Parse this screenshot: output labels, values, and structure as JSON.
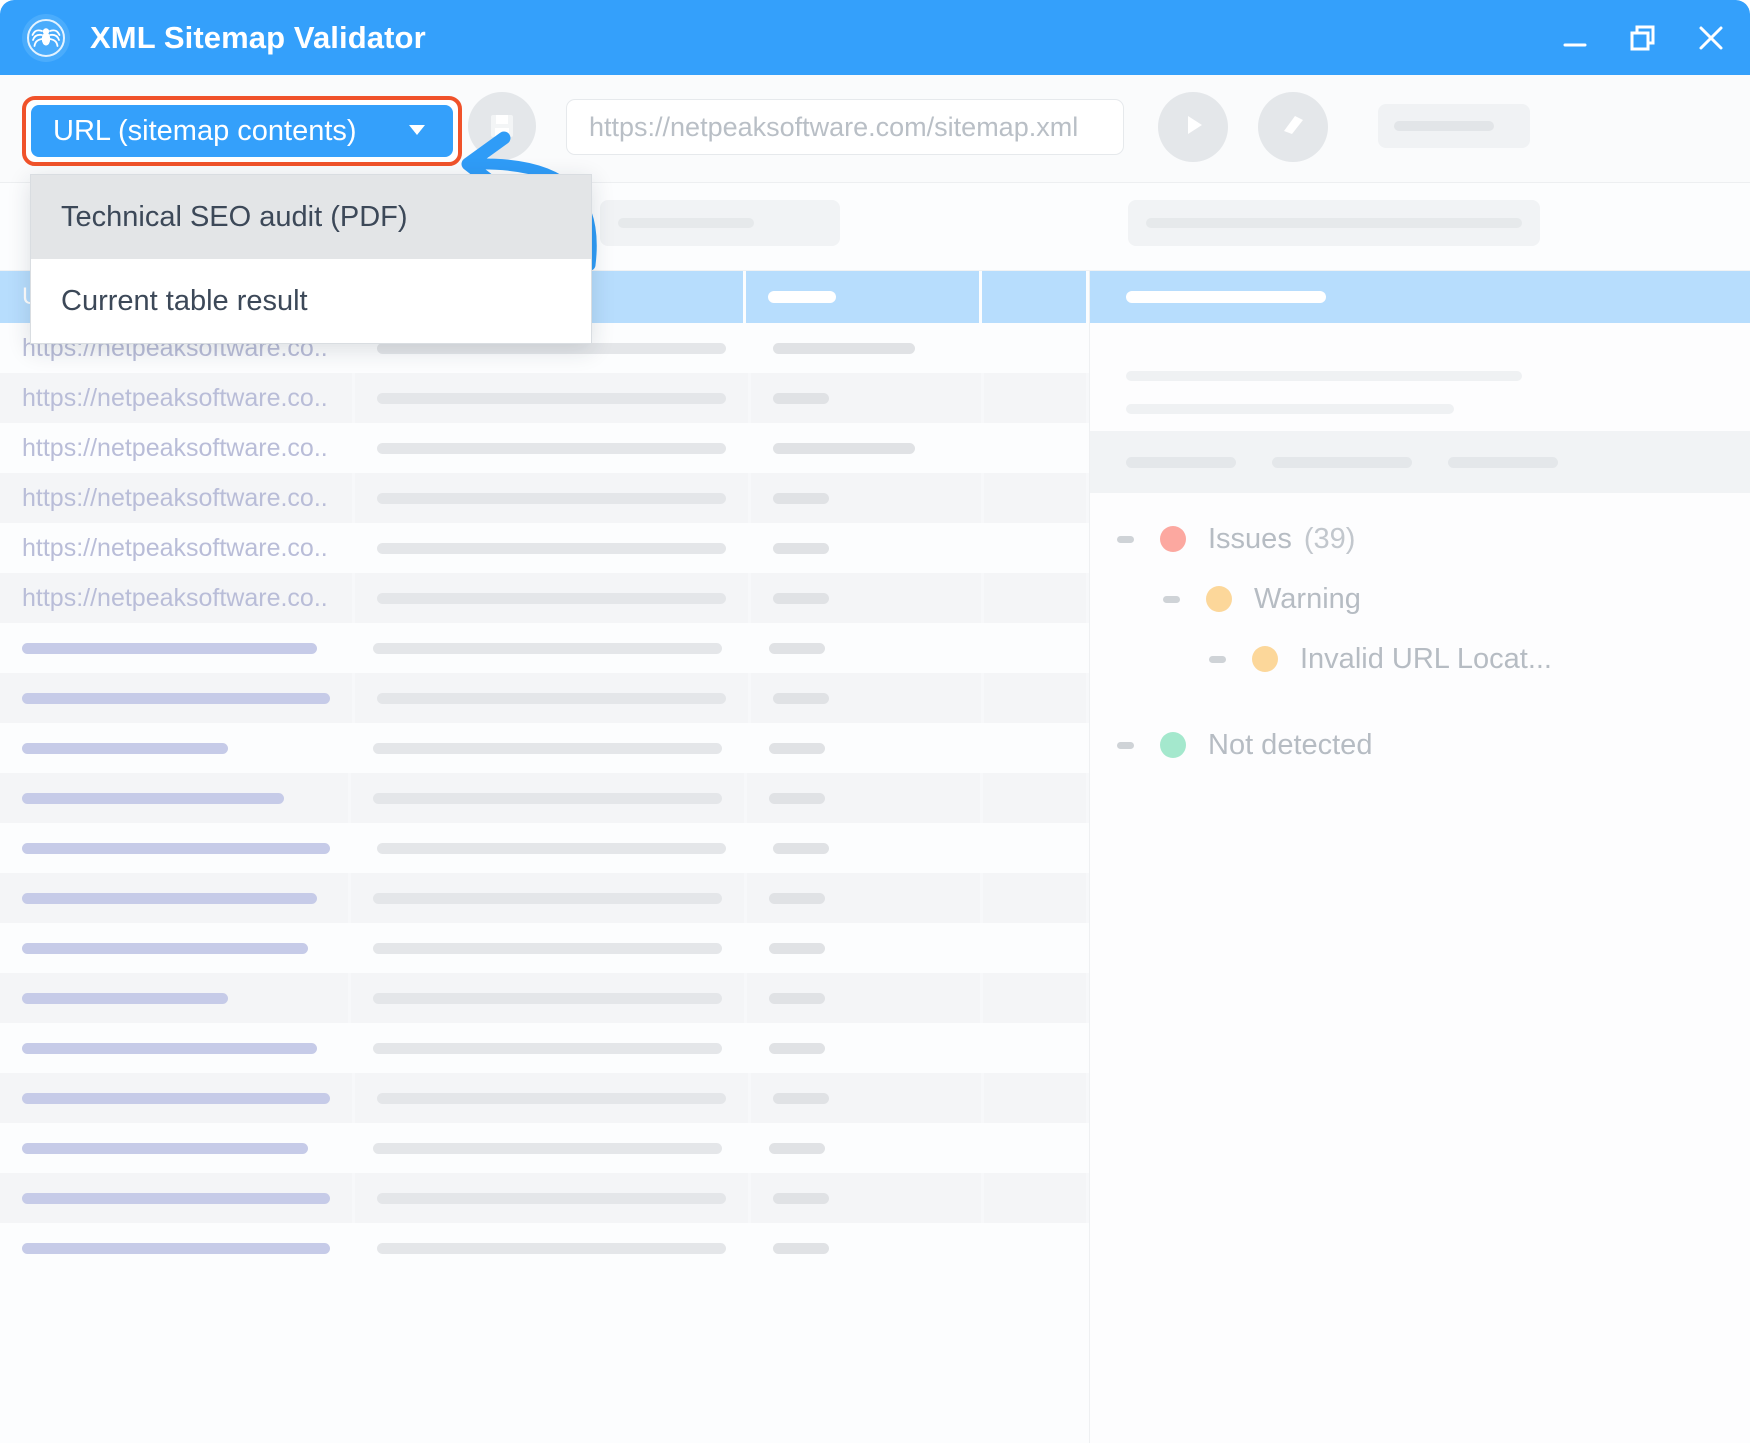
{
  "window": {
    "title": "XML Sitemap Validator",
    "logo_icon": "spider-icon",
    "minimize_icon": "minimize-icon",
    "restore_icon": "restore-window-icon",
    "close_icon": "close-icon"
  },
  "toolbar": {
    "source_select": {
      "label": "URL (sitemap contents)",
      "caret_icon": "chevron-down-icon",
      "highlight_color": "#f0522a",
      "accent_color": "#34a0fb"
    },
    "url_input": {
      "value": "https://netpeaksoftware.com/sitemap.xml",
      "placeholder": "https://netpeaksoftware.com/sitemap.xml"
    },
    "start_button_icon": "play-icon",
    "clear_button_icon": "eraser-icon",
    "export_button_icon": "save-icon"
  },
  "dropdown": {
    "open": true,
    "items": [
      {
        "label": "Technical SEO audit (PDF)",
        "hovered": true
      },
      {
        "label": "Current table result",
        "hovered": false
      }
    ]
  },
  "annotation": {
    "arrow_color": "#2f9cf7",
    "arrow_icon": "curved-left-arrow-icon"
  },
  "table": {
    "columns": [
      {
        "key": "url",
        "header_label": "URL",
        "header_bar_width": 50
      },
      {
        "key": "col2",
        "header_label": "",
        "header_bar_width": 200
      },
      {
        "key": "col3",
        "header_label": "",
        "header_bar_width": 68
      },
      {
        "key": "col4",
        "header_label": "",
        "header_bar_width": 0
      }
    ],
    "rows": [
      {
        "url_text": "https://netpeaksoftware.co...",
        "bar1": 0,
        "bar2": 360,
        "bar3": 142,
        "alt": false
      },
      {
        "url_text": "https://netpeaksoftware.co...",
        "bar1": 0,
        "bar2": 360,
        "bar3": 56,
        "alt": true
      },
      {
        "url_text": "https://netpeaksoftware.co...",
        "bar1": 0,
        "bar2": 360,
        "bar3": 142,
        "alt": false
      },
      {
        "url_text": "https://netpeaksoftware.co...",
        "bar1": 0,
        "bar2": 360,
        "bar3": 56,
        "alt": true
      },
      {
        "url_text": "https://netpeaksoftware.co...",
        "bar1": 0,
        "bar2": 360,
        "bar3": 56,
        "alt": false
      },
      {
        "url_text": "https://netpeaksoftware.co...",
        "bar1": 0,
        "bar2": 360,
        "bar3": 56,
        "alt": true
      },
      {
        "url_text": "",
        "bar1": 295,
        "bar2": 360,
        "bar3": 56,
        "alt": false
      },
      {
        "url_text": "",
        "bar1": 311,
        "bar2": 360,
        "bar3": 56,
        "alt": true
      },
      {
        "url_text": "",
        "bar1": 206,
        "bar2": 360,
        "bar3": 56,
        "alt": false
      },
      {
        "url_text": "",
        "bar1": 262,
        "bar2": 360,
        "bar3": 56,
        "alt": true
      },
      {
        "url_text": "",
        "bar1": 311,
        "bar2": 360,
        "bar3": 56,
        "alt": false
      },
      {
        "url_text": "",
        "bar1": 295,
        "bar2": 360,
        "bar3": 56,
        "alt": true
      },
      {
        "url_text": "",
        "bar1": 286,
        "bar2": 360,
        "bar3": 56,
        "alt": false
      },
      {
        "url_text": "",
        "bar1": 206,
        "bar2": 360,
        "bar3": 56,
        "alt": true
      },
      {
        "url_text": "",
        "bar1": 295,
        "bar2": 360,
        "bar3": 56,
        "alt": false
      },
      {
        "url_text": "",
        "bar1": 311,
        "bar2": 360,
        "bar3": 56,
        "alt": true
      },
      {
        "url_text": "",
        "bar1": 286,
        "bar2": 360,
        "bar3": 56,
        "alt": false
      },
      {
        "url_text": "",
        "bar1": 311,
        "bar2": 360,
        "bar3": 56,
        "alt": true
      },
      {
        "url_text": "",
        "bar1": 311,
        "bar2": 360,
        "bar3": 56,
        "alt": false
      }
    ]
  },
  "sidebar": {
    "header_bar_width": 200,
    "tree": [
      {
        "level": 1,
        "label": "Issues",
        "count": "(39)",
        "dot_color": "#fca8a0",
        "toggle_icon": "collapse-minus-icon"
      },
      {
        "level": 2,
        "label": "Warning",
        "count": "",
        "dot_color": "#fcd79a",
        "toggle_icon": "collapse-minus-icon"
      },
      {
        "level": 3,
        "label": "Invalid URL Locat...",
        "count": "",
        "dot_color": "#fcd79a",
        "toggle_icon": "collapse-minus-icon"
      },
      {
        "level": 1,
        "label": "Not detected",
        "count": "",
        "dot_color": "#a4e8cd",
        "toggle_icon": "collapse-minus-icon"
      }
    ]
  }
}
